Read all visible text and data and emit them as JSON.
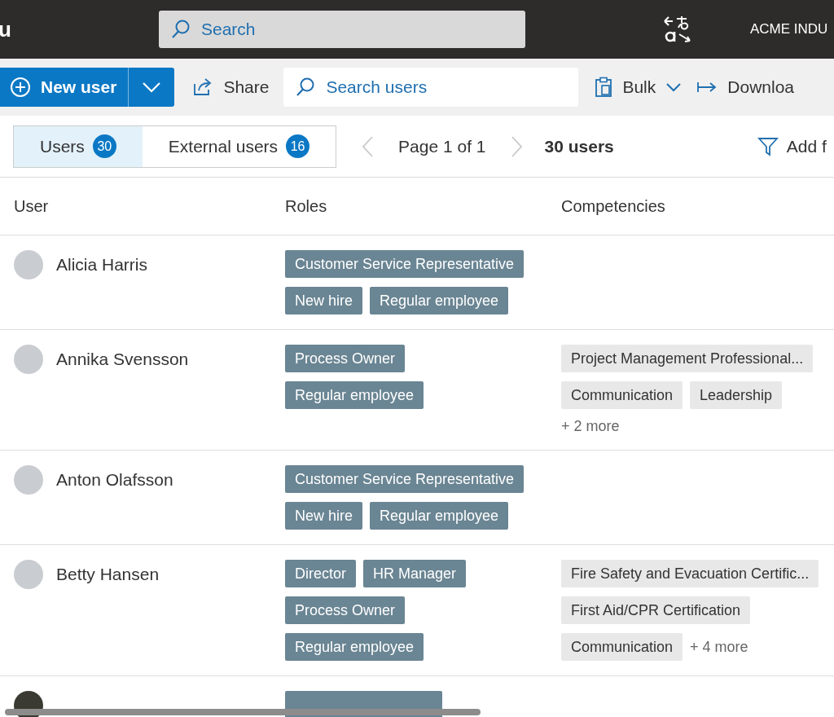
{
  "topbar": {
    "logo_text": "u",
    "search": {
      "placeholder": "Search"
    },
    "org": "ACME INDU"
  },
  "toolbar": {
    "new_user": "New user",
    "share": "Share",
    "search": {
      "placeholder": "Search users"
    },
    "bulk": "Bulk",
    "download": "Downloa"
  },
  "tabs": [
    {
      "label": "Users",
      "count": "30",
      "selected": true
    },
    {
      "label": "External users",
      "count": "16",
      "selected": false
    }
  ],
  "pager": {
    "page": "Page 1 of 1",
    "total": "30 users",
    "filter": "Add f"
  },
  "table": {
    "columns": [
      "User",
      "Roles",
      "Competencies"
    ],
    "rows": [
      {
        "name": "Alicia Harris",
        "roles": [
          "Customer Service Representative",
          "New hire",
          "Regular employee"
        ],
        "competencies": []
      },
      {
        "name": "Annika Svensson",
        "roles": [
          "Process Owner",
          "Regular employee"
        ],
        "competencies": [
          "Project Management Professional...",
          "Communication",
          "Leadership"
        ],
        "more": "+ 2 more"
      },
      {
        "name": "Anton Olafsson",
        "roles": [
          "Customer Service Representative",
          "New hire",
          "Regular employee"
        ],
        "competencies": []
      },
      {
        "name": "Betty Hansen",
        "roles": [
          "Director",
          "HR Manager",
          "Process Owner",
          "Regular employee"
        ],
        "competencies": [
          "Fire Safety and Evacuation Certific...",
          "First Aid/CPR Certification",
          "Communication"
        ],
        "more": "+ 4 more"
      }
    ]
  }
}
